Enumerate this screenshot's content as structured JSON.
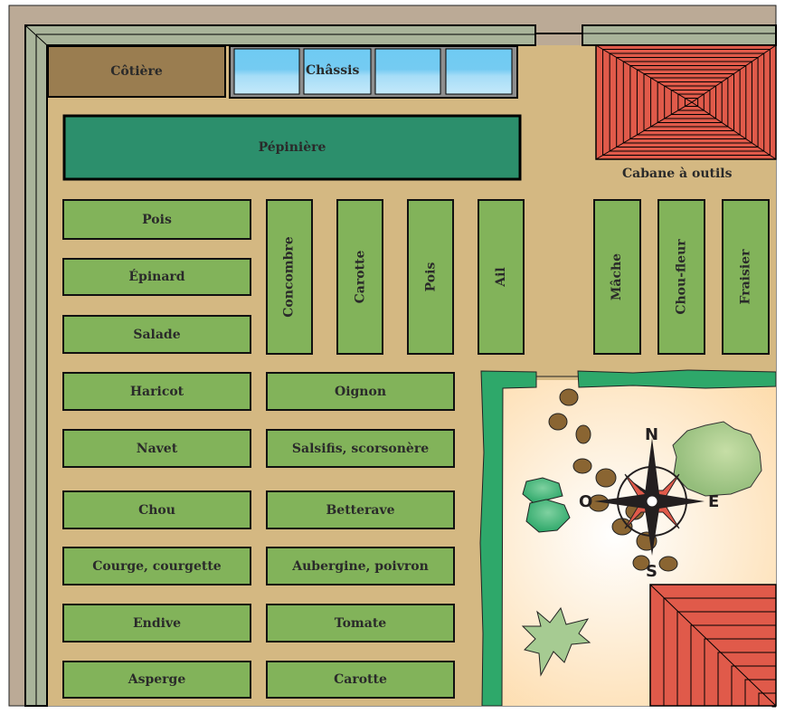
{
  "colors": {
    "ground": "#D4B882",
    "border": "#BBAA96",
    "wall": "#A9B49A",
    "bed": "#82B35A",
    "nursery": "#2C8F6C",
    "coldframe_glass": "#74CBF2",
    "cotiere": "#9A7D50",
    "roof": "#E05A4A",
    "hedge": "#2EA86A",
    "courtyard": "#FDD9A5",
    "stone": "#8A6532"
  },
  "top": {
    "cotiere": "Côtière",
    "chassis": "Châssis",
    "pepiniere": "Pépinière",
    "shed": "Cabane à outils"
  },
  "left_column": [
    "Pois",
    "Épinard",
    "Salade",
    "Haricot",
    "Navet",
    "Chou",
    "Courge, courgette",
    "Endive",
    "Asperge"
  ],
  "middle_column": [
    "Oignon",
    "Salsifis, scorsonère",
    "Betterave",
    "Aubergine, poivron",
    "Tomate",
    "Carotte"
  ],
  "vertical_beds": [
    "Concombre",
    "Carotte",
    "Pois",
    "Ail"
  ],
  "right_beds": [
    "Mâche",
    "Chou-fleur",
    "Fraisier"
  ],
  "compass": {
    "n": "N",
    "s": "S",
    "e": "E",
    "w": "O"
  }
}
